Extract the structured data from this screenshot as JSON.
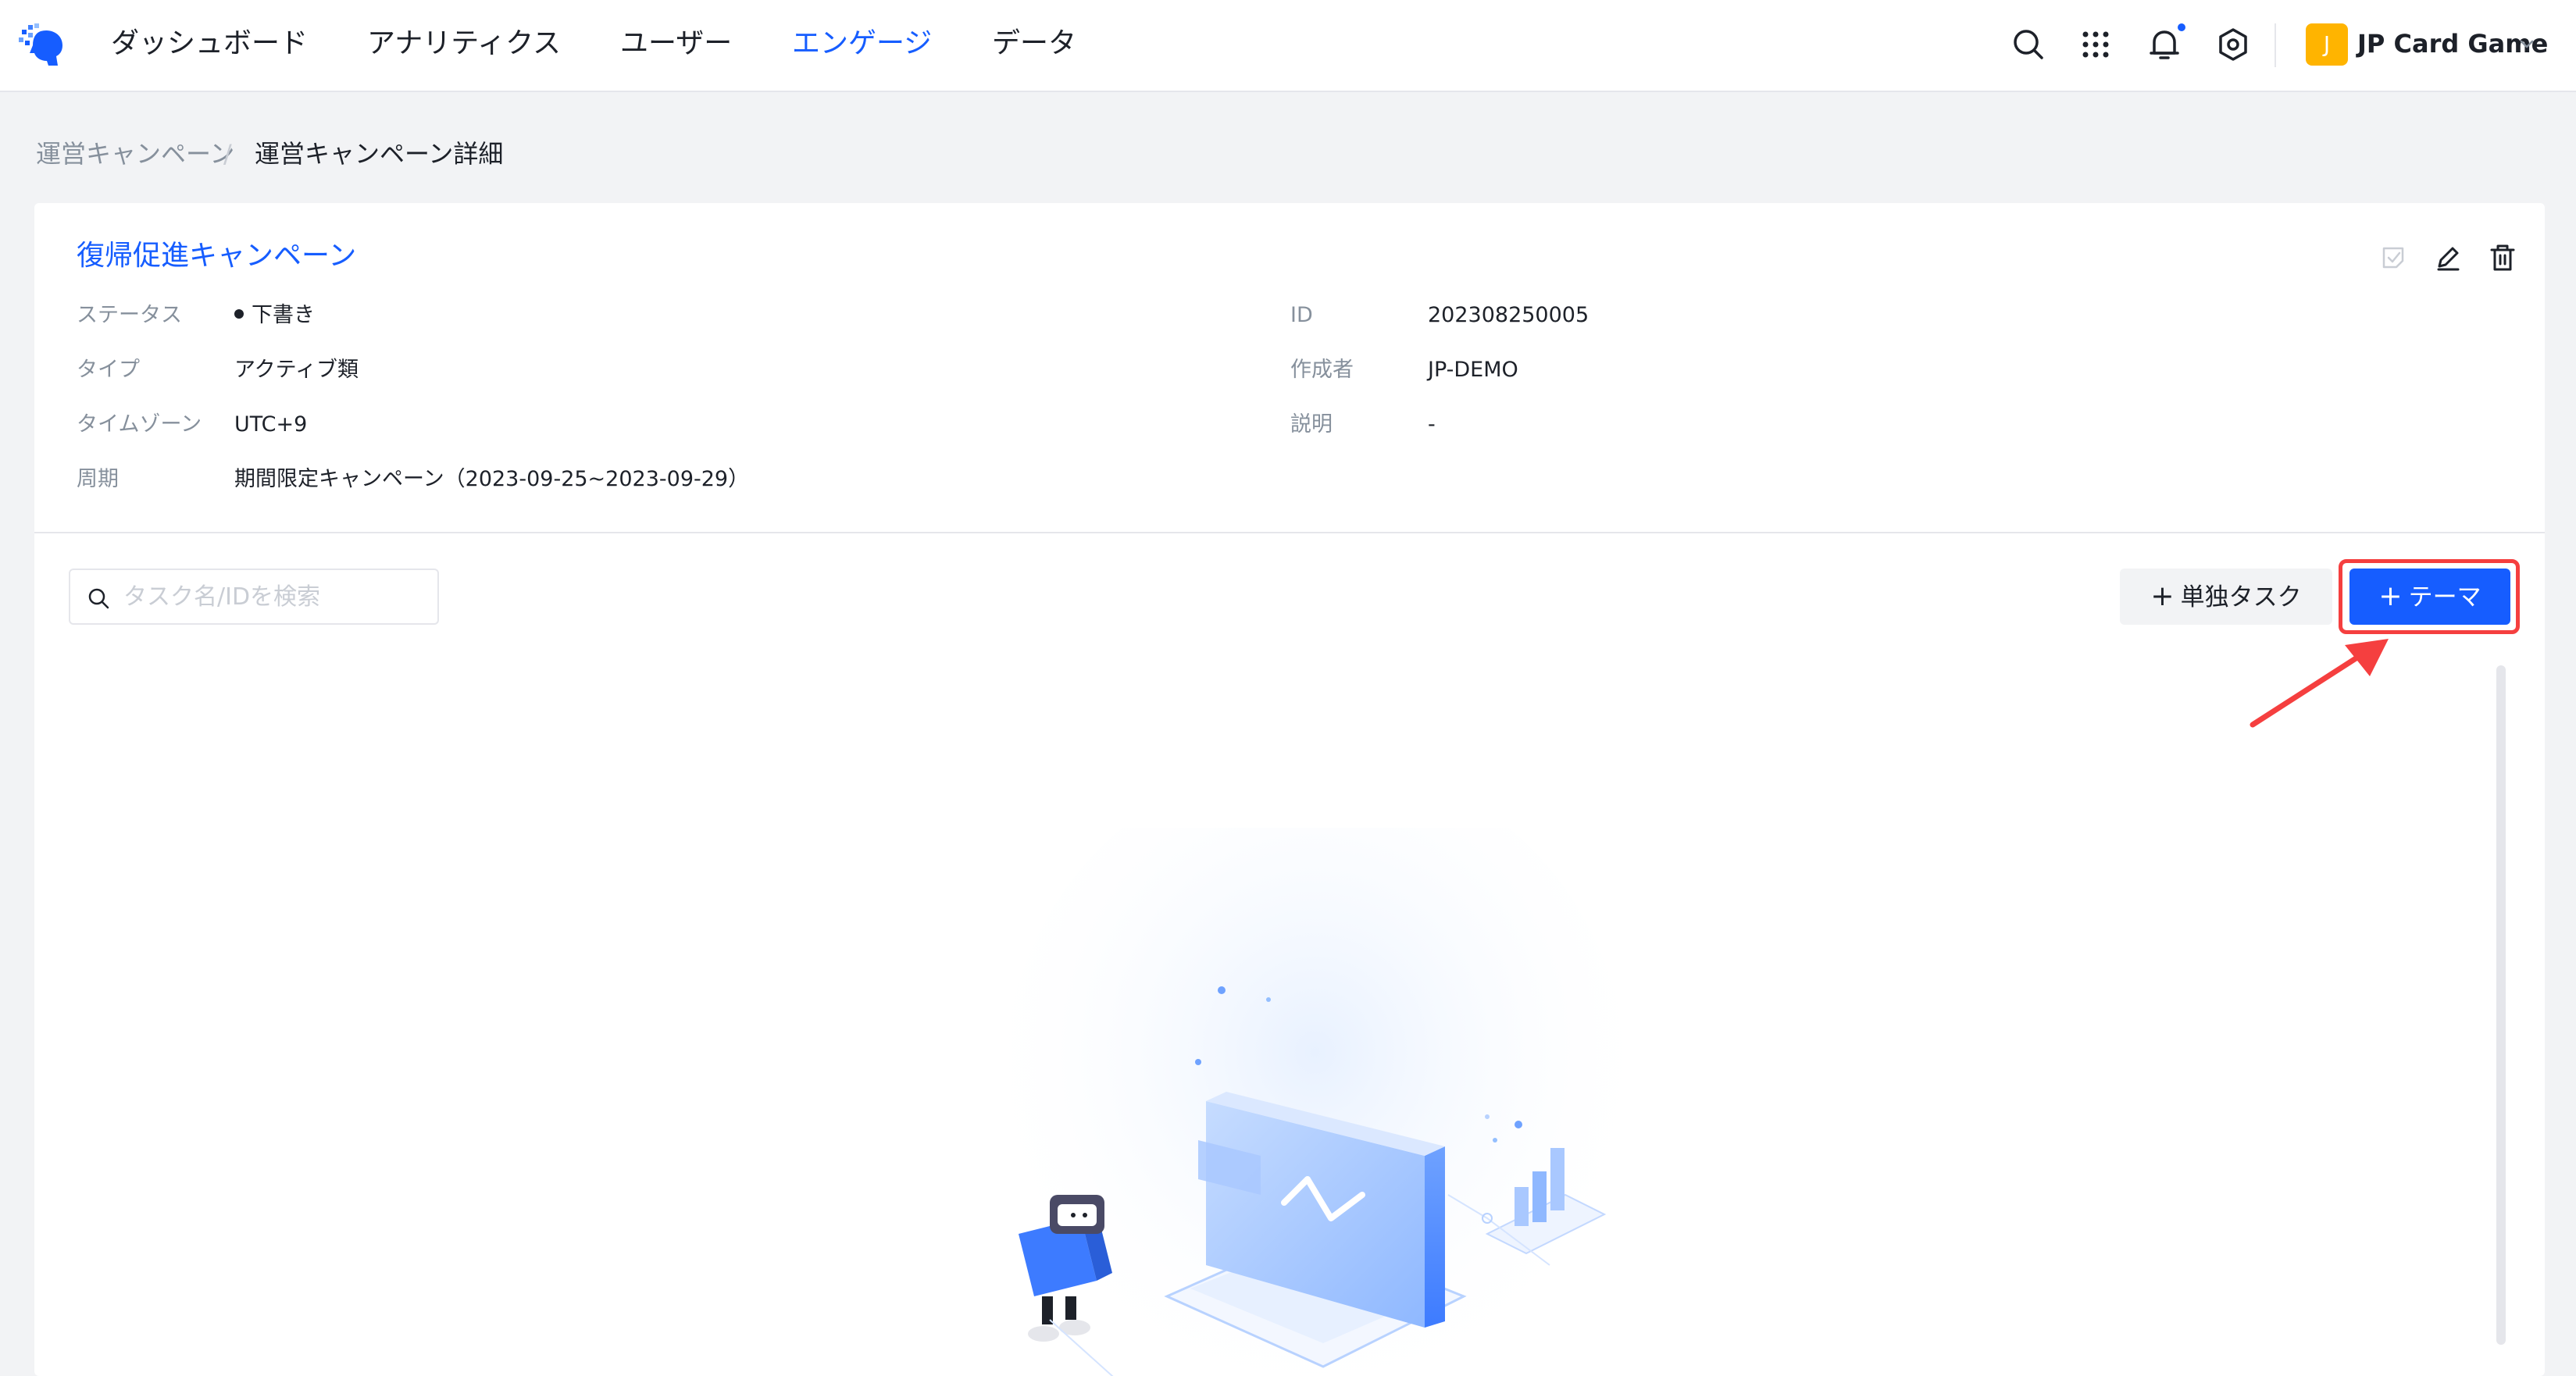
{
  "nav": {
    "items": [
      {
        "label": "ダッシュボード",
        "active": false
      },
      {
        "label": "アナリティクス",
        "active": false
      },
      {
        "label": "ユーザー",
        "active": false
      },
      {
        "label": "エンゲージ",
        "active": true
      },
      {
        "label": "データ",
        "active": false
      }
    ],
    "icons": [
      "search-icon",
      "apps-grid-icon",
      "bell-icon",
      "settings-icon"
    ],
    "project": {
      "avatar_letter": "J",
      "name": "JP Card Game"
    }
  },
  "breadcrumb": {
    "parent": "運営キャンペーン",
    "separator": "/",
    "current": "運営キャンペーン詳細"
  },
  "campaign": {
    "title": "復帰促進キャンペーン",
    "fields_left": [
      {
        "label": "ステータス",
        "value": "下書き"
      },
      {
        "label": "タイプ",
        "value": "アクティブ類"
      },
      {
        "label": "タイムゾーン",
        "value": "UTC+9"
      },
      {
        "label": "周期",
        "value": "期間限定キャンペーン（2023-09-25~2023-09-29）"
      }
    ],
    "fields_right": [
      {
        "label": "ID",
        "value": "202308250005"
      },
      {
        "label": "作成者",
        "value": "JP-DEMO"
      },
      {
        "label": "説明",
        "value": "-"
      }
    ],
    "actions": [
      "publish-icon",
      "edit-icon",
      "delete-icon"
    ]
  },
  "tasks": {
    "search_placeholder": "タスク名/IDを検索",
    "single_task_button": "単独タスク",
    "theme_button": "テーマ",
    "plus": "+"
  },
  "colors": {
    "accent": "#165dff",
    "highlight": "#f53f3f",
    "avatar": "#ffb400"
  }
}
